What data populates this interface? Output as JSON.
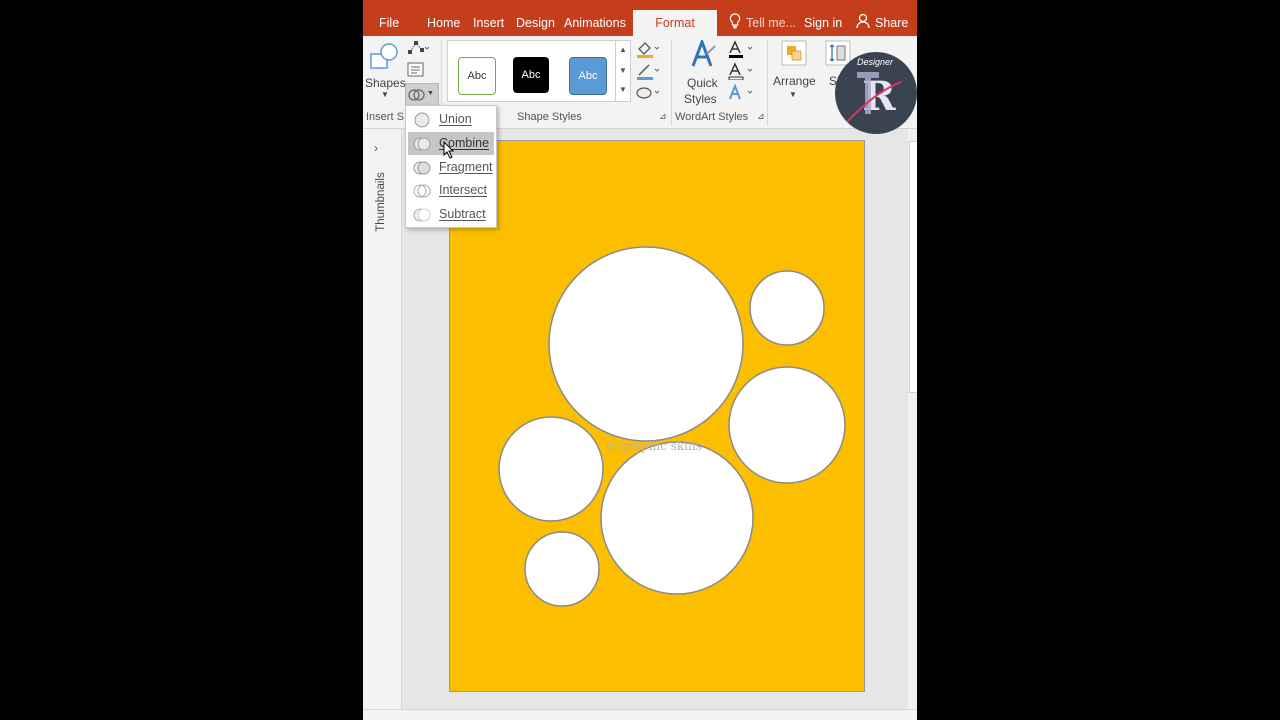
{
  "tabs": {
    "file": "File",
    "home": "Home",
    "insert": "Insert",
    "design": "Design",
    "animations": "Animations",
    "format": "Format",
    "tell_me": "Tell me...",
    "sign_in": "Sign in",
    "share": "Share"
  },
  "ribbon": {
    "shapes_label": "Shapes",
    "insert_shapes_label": "Insert S",
    "style_preset_text": "Abc",
    "shape_styles_label": "Shape Styles",
    "quick_label": "Quick",
    "styles_label": "Styles",
    "wordart_styles_label": "WordArt Styles",
    "arrange_label": "Arrange",
    "size_label": "Size"
  },
  "merge_menu": {
    "items": [
      {
        "label": "Union"
      },
      {
        "label": "Combine"
      },
      {
        "label": "Fragment"
      },
      {
        "label": "Intersect"
      },
      {
        "label": "Subtract"
      }
    ],
    "highlighted": "Combine"
  },
  "left_pane": {
    "thumbnails_label": "Thumbnails"
  },
  "slide": {
    "watermark": "tr graphic skills",
    "background_color": "#fbbf00",
    "circle_color": "#ffffff"
  },
  "logo": {
    "text": "Designer"
  },
  "colors": {
    "ribbon_accent": "#c43e1c",
    "style_white": "#ffffff",
    "style_black": "#000000",
    "style_blue": "#5b9bd5"
  }
}
